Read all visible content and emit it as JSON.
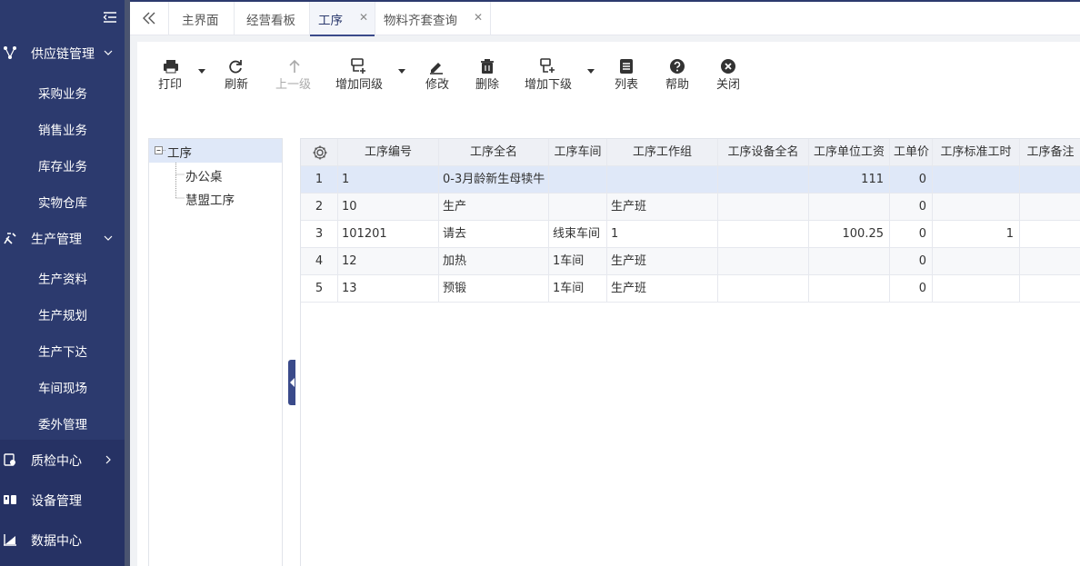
{
  "sidebar": {
    "groups": [
      {
        "label": "供应链管理",
        "icon": "supply-chain-icon",
        "chevron": "down"
      },
      {
        "label": "生产管理",
        "icon": "production-icon",
        "chevron": "down"
      },
      {
        "label": "质检中心",
        "icon": "quality-icon",
        "chevron": "right"
      },
      {
        "label": "设备管理",
        "icon": "equipment-icon",
        "chevron": "none"
      },
      {
        "label": "数据中心",
        "icon": "data-center-icon",
        "chevron": "none"
      }
    ],
    "supply_items": [
      "采购业务",
      "销售业务",
      "库存业务",
      "实物仓库"
    ],
    "production_items": [
      "生产资料",
      "生产规划",
      "生产下达",
      "车间现场",
      "委外管理"
    ]
  },
  "tabs": [
    {
      "label": "主界面",
      "closable": false
    },
    {
      "label": "经营看板",
      "closable": false
    },
    {
      "label": "工序",
      "closable": true,
      "active": true
    },
    {
      "label": "物料齐套查询",
      "closable": true
    }
  ],
  "toolbar": {
    "print": "打印",
    "refresh": "刷新",
    "up_level": "上一级",
    "add_sibling": "增加同级",
    "edit": "修改",
    "delete": "删除",
    "add_child": "增加下级",
    "list": "列表",
    "help": "帮助",
    "close": "关闭"
  },
  "tree": {
    "root": "工序",
    "children": [
      "办公桌",
      "慧盟工序"
    ]
  },
  "grid": {
    "columns": [
      "工序编号",
      "工序全名",
      "工序车间",
      "工序工作组",
      "工序设备全名",
      "工序单位工资",
      "工单价",
      "工序标准工时",
      "工序备注"
    ],
    "rows": [
      {
        "n": "1",
        "code": "1",
        "name": "0-3月龄新生母犊牛",
        "shop": "",
        "group": "",
        "equip": "",
        "wage": "111",
        "price": "0",
        "std": "",
        "note": ""
      },
      {
        "n": "2",
        "code": "10",
        "name": "生产",
        "shop": "",
        "group": "生产班",
        "equip": "",
        "wage": "",
        "price": "0",
        "std": "",
        "note": ""
      },
      {
        "n": "3",
        "code": "101201",
        "name": "请去",
        "shop": "线束车间",
        "group": "1",
        "equip": "",
        "wage": "100.25",
        "price": "0",
        "std": "1",
        "note": ""
      },
      {
        "n": "4",
        "code": "12",
        "name": "加热",
        "shop": "1车间",
        "group": "生产班",
        "equip": "",
        "wage": "",
        "price": "0",
        "std": "",
        "note": ""
      },
      {
        "n": "5",
        "code": "13",
        "name": "预锻",
        "shop": "1车间",
        "group": "生产班",
        "equip": "",
        "wage": "",
        "price": "0",
        "std": "",
        "note": ""
      }
    ]
  },
  "colors": {
    "sidebar": "#2c3a6e",
    "accent": "#3a4a8a",
    "selected_row": "#dfe8f8"
  }
}
